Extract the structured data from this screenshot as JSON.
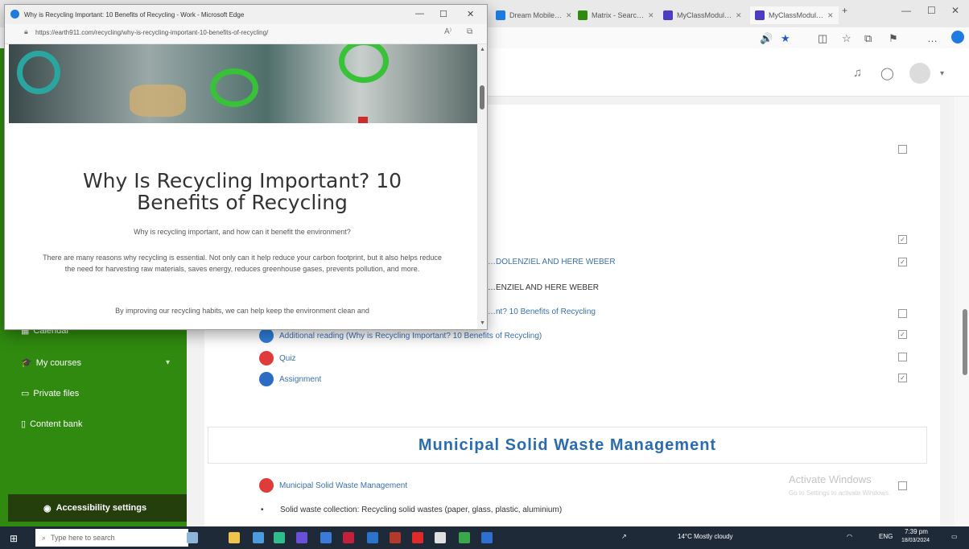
{
  "background_browser": {
    "tabs": [
      {
        "label": "Dream Mobile…",
        "color": "#1e7be0"
      },
      {
        "label": "Matrix - Searc…",
        "color": "#2f8a0f"
      },
      {
        "label": "MyClassModul…",
        "color": "#4b3cc1"
      },
      {
        "label": "MyClassModul…",
        "color": "#4b3cc1"
      }
    ],
    "window_controls": {
      "minimize": "—",
      "maximize": "☐",
      "close": "✕"
    }
  },
  "sidebar": {
    "items": [
      {
        "label": "Calendar",
        "icon": "calendar-icon"
      },
      {
        "label": "My courses",
        "icon": "mortarboard-icon"
      },
      {
        "label": "Private files",
        "icon": "folder-icon"
      },
      {
        "label": "Content bank",
        "icon": "page-icon"
      }
    ],
    "accessibility": "Accessibility settings"
  },
  "course": {
    "activities_top": [
      {
        "text": "…DOLENZIEL AND HERE WEBER",
        "type": "link"
      },
      {
        "text": "…ENZIEL AND HERE WEBER",
        "type": "plain"
      },
      {
        "text": "…nt? 10 Benefits of Recycling",
        "type": "link"
      }
    ],
    "activities": [
      {
        "label": "Additional reading (Why is Recycling Important? 10 Benefits of Recycling)",
        "icon_color": "#2f7ed8"
      },
      {
        "label": "Quiz",
        "icon_color": "#e03a3a"
      },
      {
        "label": "Assignment",
        "icon_color": "#2b6cc4"
      }
    ],
    "section_title": "Municipal Solid Waste Management",
    "section_activity": "Municipal Solid Waste Management",
    "bullet": "Solid waste collection: Recycling solid wastes (paper, glass, plastic, aluminium)"
  },
  "watermark": {
    "title": "Activate Windows",
    "subtitle": "Go to Settings to activate Windows."
  },
  "popup": {
    "window_title": "Why is Recycling Important: 10 Benefits of Recycling - Work - Microsoft Edge",
    "url": "https://earth911.com/recycling/why-is-recycling-important-10-benefits-of-recycling/",
    "heading": "Why Is Recycling Important? 10 Benefits of Recycling",
    "subtitle": "Why is recycling important, and how can it benefit the environment?",
    "paragraph": "There are many reasons why recycling is essential. Not only can it help reduce your carbon footprint, but it also helps reduce the need for harvesting raw materials, saves energy, reduces greenhouse gases, prevents pollution, and more.",
    "paragraph2": "By improving our recycling habits, we can help keep the environment clean and"
  },
  "taskbar": {
    "search_placeholder": "Type here to search",
    "weather": "14°C Mostly cloudy",
    "lang": "ENG",
    "time": "7:39 pm",
    "date": "18/03/2024"
  }
}
